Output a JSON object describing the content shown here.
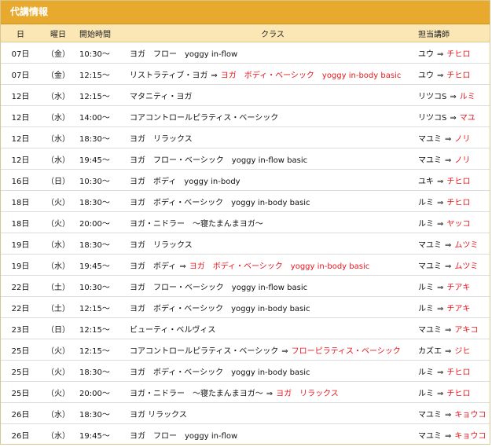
{
  "title": "代講情報",
  "headers": {
    "day": "日",
    "dow": "曜日",
    "time": "開始時間",
    "class": "クラス",
    "teacher": "担当講師"
  },
  "arrow": "⇒",
  "rows": [
    {
      "day": "07日",
      "dow": "（金）",
      "time": "10:30～",
      "class_from": "ヨガ　フロー　yoggy in-flow",
      "class_to": "",
      "teacher_from": "ユウ",
      "teacher_to": "チヒロ"
    },
    {
      "day": "07日",
      "dow": "（金）",
      "time": "12:15～",
      "class_from": "リストラティブ・ヨガ",
      "class_to": "ヨガ　ボディ・ベーシック　yoggy in-body basic",
      "teacher_from": "ユウ",
      "teacher_to": "チヒロ"
    },
    {
      "day": "12日",
      "dow": "（水）",
      "time": "12:15～",
      "class_from": "マタニティ・ヨガ",
      "class_to": "",
      "teacher_from": "リツコS",
      "teacher_to": "ルミ"
    },
    {
      "day": "12日",
      "dow": "（水）",
      "time": "14:00～",
      "class_from": "コアコントロールピラティス・ベーシック",
      "class_to": "",
      "teacher_from": "リツコS",
      "teacher_to": "マユ"
    },
    {
      "day": "12日",
      "dow": "（水）",
      "time": "18:30～",
      "class_from": "ヨガ　リラックス",
      "class_to": "",
      "teacher_from": "マユミ",
      "teacher_to": "ノリ"
    },
    {
      "day": "12日",
      "dow": "（水）",
      "time": "19:45～",
      "class_from": "ヨガ　フロー・ベーシック　yoggy in-flow basic",
      "class_to": "",
      "teacher_from": "マユミ",
      "teacher_to": "ノリ"
    },
    {
      "day": "16日",
      "dow": "（日）",
      "time": "10:30～",
      "class_from": "ヨガ　ボディ　yoggy in-body",
      "class_to": "",
      "teacher_from": "ユキ",
      "teacher_to": "チヒロ"
    },
    {
      "day": "18日",
      "dow": "（火）",
      "time": "18:30～",
      "class_from": "ヨガ　ボディ・ベーシック　yoggy in-body basic",
      "class_to": "",
      "teacher_from": "ルミ",
      "teacher_to": "チヒロ"
    },
    {
      "day": "18日",
      "dow": "（火）",
      "time": "20:00～",
      "class_from": "ヨガ・ニドラー　～寝たまんまヨガ～",
      "class_to": "",
      "teacher_from": "ルミ",
      "teacher_to": "ヤッコ"
    },
    {
      "day": "19日",
      "dow": "（水）",
      "time": "18:30～",
      "class_from": "ヨガ　リラックス",
      "class_to": "",
      "teacher_from": "マユミ",
      "teacher_to": "ムツミ"
    },
    {
      "day": "19日",
      "dow": "（水）",
      "time": "19:45～",
      "class_from": "ヨガ　ボディ",
      "class_to": "ヨガ　ボディ・ベーシック　yoggy in-body basic",
      "teacher_from": "マユミ",
      "teacher_to": "ムツミ"
    },
    {
      "day": "22日",
      "dow": "（土）",
      "time": "10:30～",
      "class_from": "ヨガ　フロー・ベーシック　yoggy in-flow basic",
      "class_to": "",
      "teacher_from": "ルミ",
      "teacher_to": "チアキ"
    },
    {
      "day": "22日",
      "dow": "（土）",
      "time": "12:15～",
      "class_from": "ヨガ　ボディ・ベーシック　yoggy in-body basic",
      "class_to": "",
      "teacher_from": "ルミ",
      "teacher_to": "チアキ"
    },
    {
      "day": "23日",
      "dow": "（日）",
      "time": "12:15～",
      "class_from": "ビューティ・ベルヴィス",
      "class_to": "",
      "teacher_from": "マユミ",
      "teacher_to": "アキコ"
    },
    {
      "day": "25日",
      "dow": "（火）",
      "time": "12:15～",
      "class_from": "コアコントロールピラティス・ベーシック",
      "class_to": "フローピラティス・ベーシック",
      "teacher_from": "カズエ",
      "teacher_to": "ジヒ"
    },
    {
      "day": "25日",
      "dow": "（火）",
      "time": "18:30～",
      "class_from": "ヨガ　ボディ・ベーシック　yoggy in-body basic",
      "class_to": "",
      "teacher_from": "ルミ",
      "teacher_to": "チヒロ"
    },
    {
      "day": "25日",
      "dow": "（火）",
      "time": "20:00～",
      "class_from": "ヨガ・ニドラー　～寝たまんまヨガ～",
      "class_to": "ヨガ　リラックス",
      "teacher_from": "ルミ",
      "teacher_to": "チヒロ"
    },
    {
      "day": "26日",
      "dow": "（水）",
      "time": "18:30～",
      "class_from": "ヨガ リラックス",
      "class_to": "",
      "teacher_from": "マユミ",
      "teacher_to": "キョウコ"
    },
    {
      "day": "26日",
      "dow": "（水）",
      "time": "19:45～",
      "class_from": "ヨガ　フロー　yoggy in-flow",
      "class_to": "",
      "teacher_from": "マユミ",
      "teacher_to": "キョウコ"
    }
  ],
  "colors": {
    "title_bar": "#e8aa2e",
    "header_row": "#fbe7b5",
    "highlight": "#e8151b"
  }
}
